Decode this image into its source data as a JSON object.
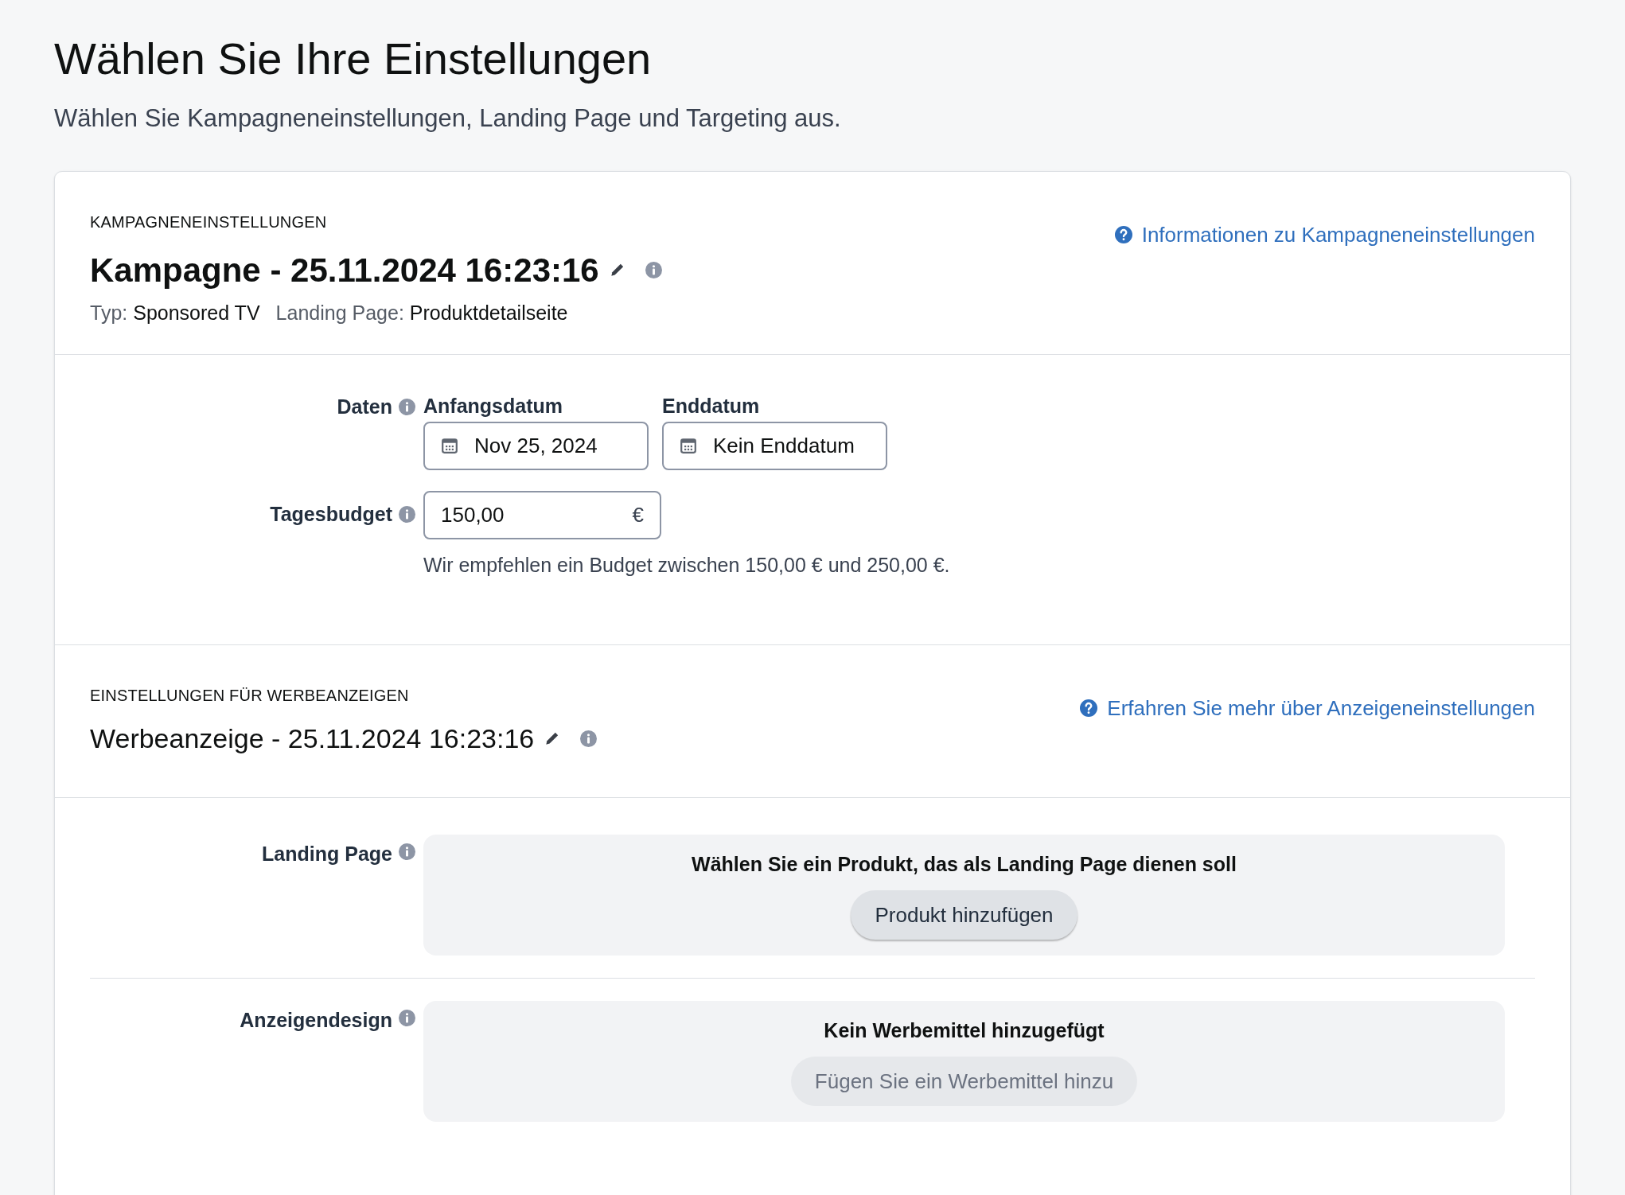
{
  "page": {
    "title": "Wählen Sie Ihre Einstellungen",
    "subtitle": "Wählen Sie Kampagneneinstellungen, Landing Page und Targeting aus."
  },
  "campaign_section": {
    "eyebrow": "KAMPAGNENEINSTELLUNGEN",
    "link": "Informationen zu Kampagneneinstellungen",
    "name": "Kampagne - 25.11.2024 16:23:16",
    "meta": [
      {
        "label": "Typ:",
        "value": "Sponsored TV"
      },
      {
        "label": "Landing Page:",
        "value": "Produktdetailseite"
      }
    ]
  },
  "schedule_section": {
    "rows": [
      {
        "kind": "dates",
        "label": "Daten",
        "fields": [
          {
            "label": "Anfangsdatum",
            "value": "Nov 25, 2024"
          },
          {
            "label": "Enddatum",
            "value": "Kein Enddatum"
          }
        ]
      },
      {
        "kind": "budget",
        "label": "Tagesbudget",
        "value": "150,00",
        "currency": "€",
        "hint": "Wir empfehlen ein Budget zwischen 150,00 € und 250,00 €."
      }
    ]
  },
  "ad_section": {
    "eyebrow": "EINSTELLUNGEN FÜR WERBEANZEIGEN",
    "link": "Erfahren Sie mehr über Anzeigeneinstellungen",
    "name": "Werbeanzeige - 25.11.2024 16:23:16",
    "rows": [
      {
        "label": "Landing Page",
        "message": "Wählen Sie ein Produkt, das als Landing Page dienen soll",
        "button": {
          "label": "Produkt hinzufügen",
          "disabled": false
        }
      },
      {
        "label": "Anzeigendesign",
        "message": "Kein Werbemittel hinzugefügt",
        "button": {
          "label": "Fügen Sie ein Werbemittel hinzu",
          "disabled": true
        }
      }
    ]
  }
}
